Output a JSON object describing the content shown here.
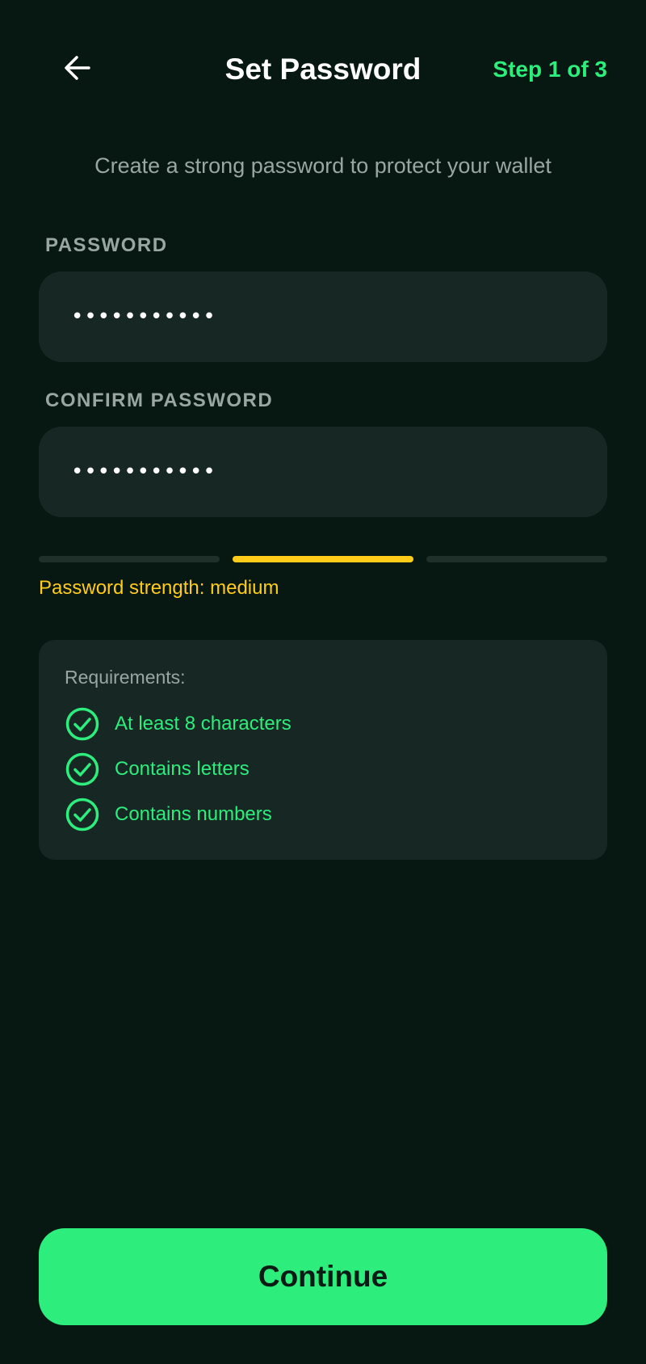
{
  "header": {
    "back_icon": "arrow-left-icon",
    "title": "Set Password",
    "step": "Step 1 of 3"
  },
  "subtitle": "Create a strong password to protect your wallet",
  "fields": {
    "password": {
      "label": "PASSWORD",
      "value": "•••••••••••"
    },
    "confirm": {
      "label": "CONFIRM PASSWORD",
      "value": "•••••••••••"
    }
  },
  "strength": {
    "level": 2,
    "of": 3,
    "text": "Password strength: medium",
    "color": "#ffcc1a"
  },
  "requirements": {
    "title": "Requirements:",
    "items": [
      {
        "label": "At least 8 characters",
        "icon": "check-circle-icon",
        "met": true
      },
      {
        "label": "Contains letters",
        "icon": "check-circle-icon",
        "met": true
      },
      {
        "label": "Contains numbers",
        "icon": "check-circle-icon",
        "met": true
      }
    ]
  },
  "continue_label": "Continue",
  "colors": {
    "background": "#071812",
    "accent": "#2ded7c",
    "warning": "#ffcc1a",
    "surface": "#172824"
  }
}
